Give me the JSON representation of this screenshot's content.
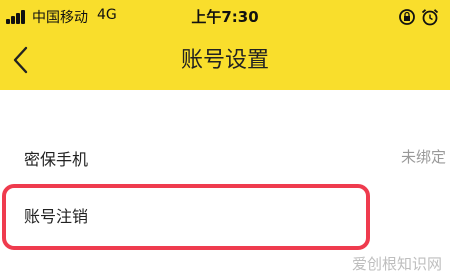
{
  "status_bar": {
    "carrier": "中国移动",
    "network": "4G",
    "time": "上午7:30"
  },
  "nav": {
    "back_icon": "chevron-left-icon",
    "title": "账号设置"
  },
  "settings": [
    {
      "label": "密保手机",
      "value": "未绑定"
    },
    {
      "label": "账号注销",
      "value": ""
    }
  ],
  "watermark": "爱创根知识网",
  "colors": {
    "header_bg": "#f9de2c",
    "highlight_border": "#ef3b4e",
    "secondary_text": "#999999"
  }
}
